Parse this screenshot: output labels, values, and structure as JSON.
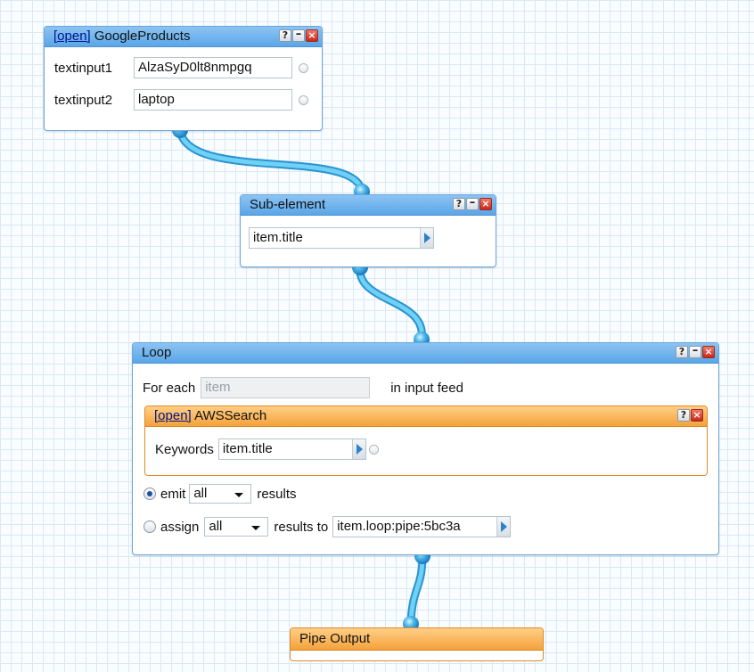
{
  "google_products": {
    "open_link": "[open]",
    "title": "GoogleProducts",
    "fields": [
      {
        "label": "textinput1",
        "value": "AlzaSyD0lt8nmpgq"
      },
      {
        "label": "textinput2",
        "value": "laptop"
      }
    ]
  },
  "sub_element": {
    "title": "Sub-element",
    "value": "item.title"
  },
  "loop": {
    "title": "Loop",
    "for_each_label": "For each",
    "for_each_placeholder": "item",
    "in_input_feed_label": "in input feed",
    "inner": {
      "open_link": "[open]",
      "title": "AWSSearch",
      "keywords_label": "Keywords",
      "keywords_value": "item.title"
    },
    "emit": {
      "label": "emit",
      "select": "all",
      "suffix": "results",
      "selected": true
    },
    "assign": {
      "label": "assign",
      "select": "all",
      "suffix": "results to",
      "target": "item.loop:pipe:5bc3a",
      "selected": false
    }
  },
  "pipe_output": {
    "title": "Pipe Output"
  },
  "buttons": {
    "help": "?",
    "minimize": "–",
    "close": "×"
  },
  "colors": {
    "module_blue": "#5aa6e8",
    "module_orange": "#f4a23b",
    "wire": "#5cc3ee",
    "link": "#00148f"
  }
}
